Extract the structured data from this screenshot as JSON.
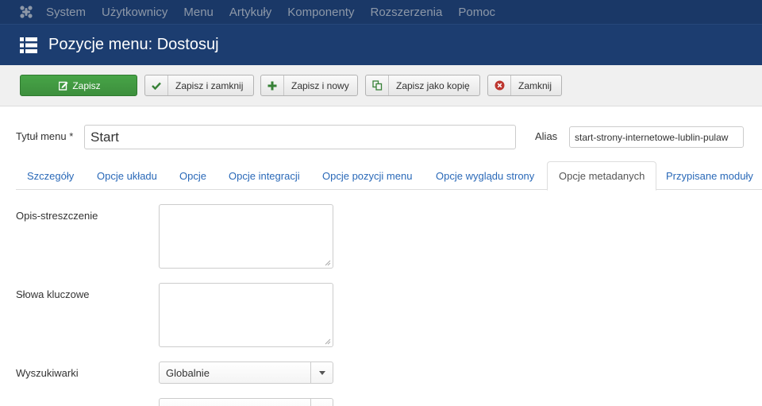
{
  "nav": {
    "items": [
      "System",
      "Użytkownicy",
      "Menu",
      "Artykuły",
      "Komponenty",
      "Rozszerzenia",
      "Pomoc"
    ]
  },
  "header": {
    "title": "Pozycje menu: Dostosuj"
  },
  "toolbar": {
    "save": "Zapisz",
    "save_close": "Zapisz i zamknij",
    "save_new": "Zapisz i nowy",
    "save_copy": "Zapisz jako kopię",
    "close": "Zamknij"
  },
  "form": {
    "title_label": "Tytuł menu *",
    "title_value": "Start",
    "alias_label": "Alias",
    "alias_value": "start-strony-internetowe-lublin-pulaw"
  },
  "tabs": [
    "Szczegóły",
    "Opcje układu",
    "Opcje",
    "Opcje integracji",
    "Opcje pozycji menu",
    "Opcje wyglądu strony",
    "Opcje metadanych",
    "Przypisane moduły"
  ],
  "active_tab": "Opcje metadanych",
  "metadata": {
    "description_label": "Opis-streszczenie",
    "keywords_label": "Słowa kluczowe",
    "robots_label": "Wyszukiwarki",
    "robots_value": "Globalnie"
  },
  "colors": {
    "navbar": "#1a3867",
    "header": "#1c3d70",
    "save_button": "#46a546",
    "link": "#2a69b8"
  }
}
